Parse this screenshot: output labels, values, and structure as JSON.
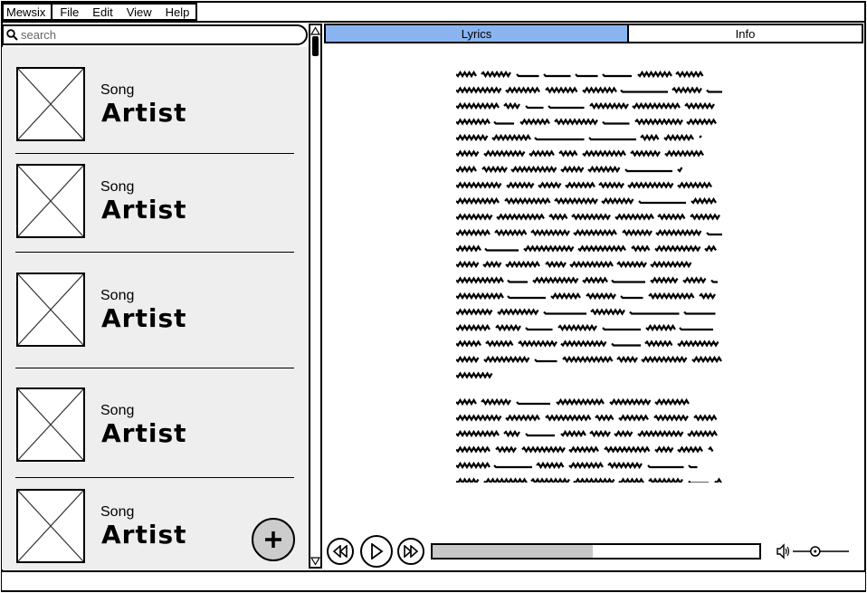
{
  "app": {
    "name": "Mewsix"
  },
  "menu": [
    {
      "label": "File"
    },
    {
      "label": "Edit"
    },
    {
      "label": "View"
    },
    {
      "label": "Help"
    }
  ],
  "search": {
    "placeholder": "search",
    "value": ""
  },
  "songs": [
    {
      "song": "Song",
      "artist": "Artist"
    },
    {
      "song": "Song",
      "artist": "Artist"
    },
    {
      "song": "Song",
      "artist": "Artist"
    },
    {
      "song": "Song",
      "artist": "Artist"
    },
    {
      "song": "Song",
      "artist": "Artist"
    }
  ],
  "tabs": [
    {
      "label": "Lyrics",
      "active": true
    },
    {
      "label": "Info",
      "active": false
    }
  ],
  "player": {
    "progress": 0.49,
    "volume": 0.4,
    "buttons": [
      "rewind-icon",
      "play-icon",
      "fast-forward-icon"
    ]
  },
  "colors": {
    "tab_active": "#8ab4f0",
    "list_bg": "#eeeeee",
    "progress_fill": "#c8c8c8"
  },
  "icons": {
    "add": "plus-icon",
    "search": "search-icon",
    "volume": "speaker-icon"
  }
}
